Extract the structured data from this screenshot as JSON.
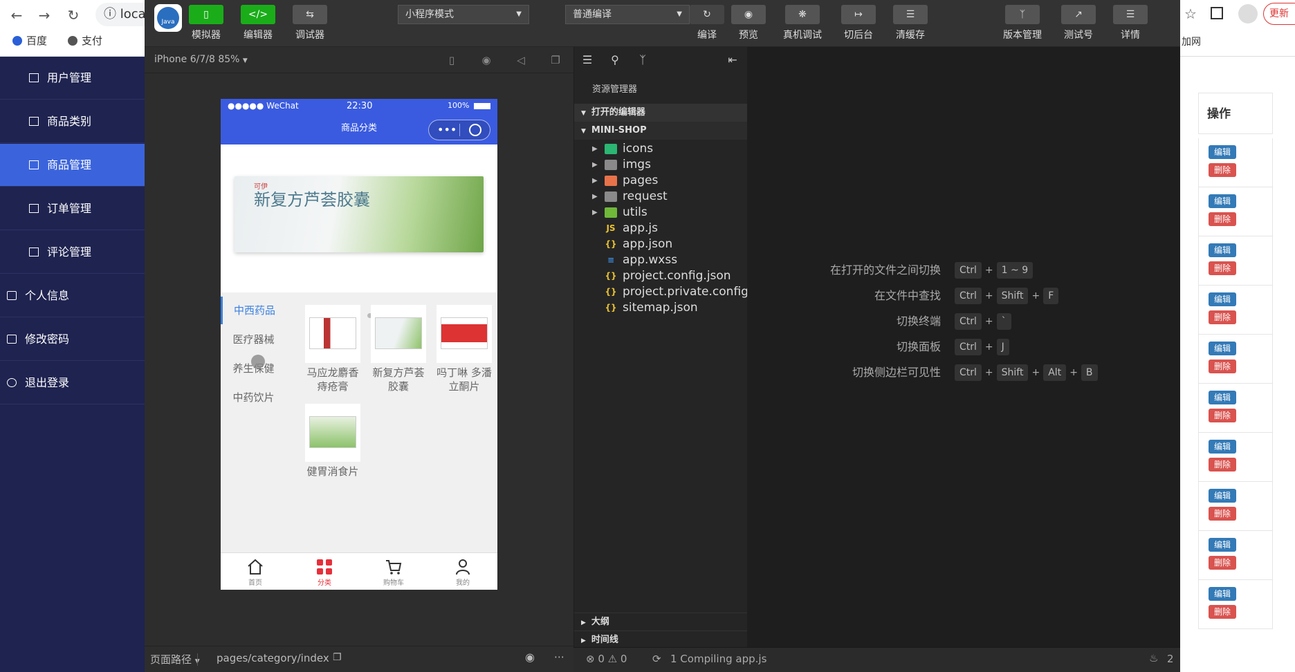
{
  "browser": {
    "url_prefix": "loca",
    "bookmarks": [
      "百度",
      "支付"
    ],
    "right_text": "更新",
    "right_link": "加网"
  },
  "admin": {
    "sidebar": [
      {
        "label": "用户管理",
        "active": false
      },
      {
        "label": "商品类别",
        "active": false
      },
      {
        "label": "商品管理",
        "active": true
      },
      {
        "label": "订单管理",
        "active": false
      },
      {
        "label": "评论管理",
        "active": false
      },
      {
        "label": "个人信息",
        "active": false
      },
      {
        "label": "修改密码",
        "active": false
      },
      {
        "label": "退出登录",
        "active": false
      }
    ],
    "table_header": "操作",
    "edit_label": "编辑",
    "delete_label": "删除",
    "row_count": 10
  },
  "ide": {
    "logo_text": "Java",
    "toolbar": {
      "simulator": "模拟器",
      "editor": "编辑器",
      "debugger": "调试器",
      "mode_select": "小程序模式",
      "compile_select": "普通编译",
      "compile": "编译",
      "preview": "预览",
      "real_debug": "真机调试",
      "background": "切后台",
      "clear_cache": "清缓存",
      "version": "版本管理",
      "test_account": "测试号",
      "details": "详情"
    },
    "simulator": {
      "device": "iPhone 6/7/8 85%",
      "page_path_label": "页面路径",
      "page_path": "pages/category/index"
    },
    "phone": {
      "carrier": "●●●●● WeChat",
      "time": "22:30",
      "battery": "100%",
      "title": "商品分类",
      "banner_brand": "可伊",
      "banner_title": "新复方芦荟胶囊",
      "categories": [
        "中西药品",
        "医疗器械",
        "养生保健",
        "中药饮片"
      ],
      "products": [
        {
          "name": "马应龙麝香痔疮膏"
        },
        {
          "name": "新复方芦荟胶囊"
        },
        {
          "name": "吗丁啉 多潘立酮片"
        },
        {
          "name": "健胃消食片"
        }
      ],
      "tabs": [
        {
          "label": "首页",
          "active": false
        },
        {
          "label": "分类",
          "active": true
        },
        {
          "label": "购物车",
          "active": false
        },
        {
          "label": "我的",
          "active": false
        }
      ]
    },
    "explorer": {
      "title": "资源管理器",
      "open_editors": "打开的编辑器",
      "project": "MINI-SHOP",
      "tree": [
        {
          "name": "icons",
          "type": "folder",
          "color": "#2bb673"
        },
        {
          "name": "imgs",
          "type": "folder",
          "color": "#8a8a8a"
        },
        {
          "name": "pages",
          "type": "folder",
          "color": "#e8734a"
        },
        {
          "name": "request",
          "type": "folder",
          "color": "#8a8a8a"
        },
        {
          "name": "utils",
          "type": "folder",
          "color": "#6fb83a"
        },
        {
          "name": "app.js",
          "type": "js",
          "color": "#e8c12e"
        },
        {
          "name": "app.json",
          "type": "json",
          "color": "#e8c12e"
        },
        {
          "name": "app.wxss",
          "type": "css",
          "color": "#3d8fe0"
        },
        {
          "name": "project.config.json",
          "type": "json",
          "color": "#e8c12e"
        },
        {
          "name": "project.private.config...",
          "type": "json",
          "color": "#e8c12e"
        },
        {
          "name": "sitemap.json",
          "type": "json",
          "color": "#e8c12e"
        }
      ],
      "outline": "大纲",
      "timeline": "时间线"
    },
    "shortcuts": [
      {
        "label": "在打开的文件之间切换",
        "keys": [
          "Ctrl",
          "1 ~ 9"
        ]
      },
      {
        "label": "在文件中查找",
        "keys": [
          "Ctrl",
          "Shift",
          "F"
        ]
      },
      {
        "label": "切换终端",
        "keys": [
          "Ctrl",
          "`"
        ]
      },
      {
        "label": "切换面板",
        "keys": [
          "Ctrl",
          "J"
        ]
      },
      {
        "label": "切换侧边栏可见性",
        "keys": [
          "Ctrl",
          "Shift",
          "Alt",
          "B"
        ]
      }
    ],
    "status": {
      "errors": "0",
      "warnings": "0",
      "compiling": "1 Compiling app.js",
      "notifications": "2"
    }
  }
}
